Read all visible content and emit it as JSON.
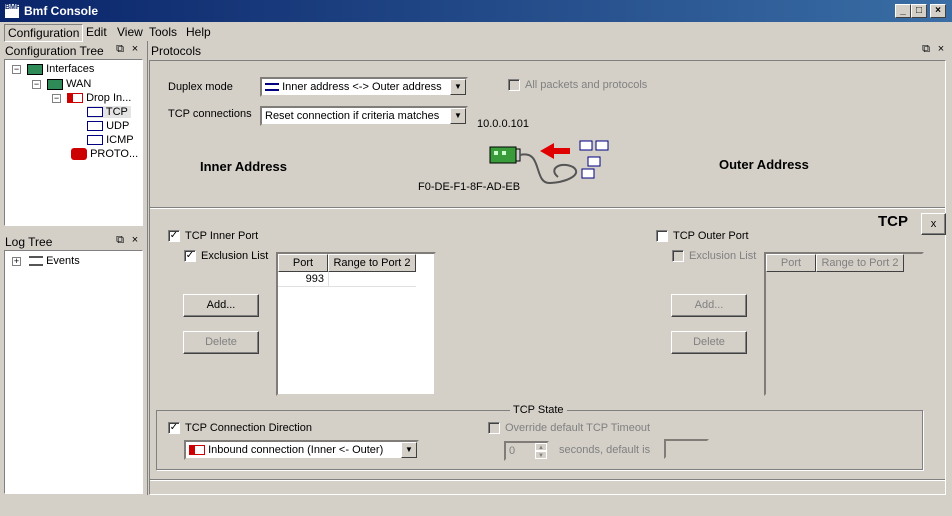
{
  "window": {
    "title": "Bmf Console",
    "icon_text": "BMF"
  },
  "menu": [
    "Configuration",
    "Edit",
    "View",
    "Tools",
    "Help"
  ],
  "config_tree": {
    "title": "Configuration Tree",
    "items": [
      "Interfaces",
      "WAN",
      "Drop In...",
      "TCP",
      "UDP",
      "ICMP",
      "PROTO..."
    ]
  },
  "log_tree": {
    "title": "Log Tree",
    "items": [
      "Events"
    ]
  },
  "protocols": {
    "title": "Protocols",
    "duplex_label": "Duplex mode",
    "duplex_value": "Inner address <-> Outer address",
    "all_packets_label": "All packets and protocols",
    "tcp_conn_label": "TCP connections",
    "tcp_conn_value": "Reset connection if criteria matches",
    "ip": "10.0.0.101",
    "mac": "F0-DE-F1-8F-AD-EB",
    "inner_address": "Inner Address",
    "outer_address": "Outer Address"
  },
  "tcp": {
    "title": "TCP",
    "close": "x",
    "inner_port_label": "TCP Inner Port",
    "inner_exclusion_label": "Exclusion List",
    "col_port": "Port",
    "col_range": "Range to Port 2",
    "inner_rows": [
      {
        "port": "993",
        "range": ""
      }
    ],
    "add": "Add...",
    "delete": "Delete",
    "outer_port_label": "TCP Outer Port",
    "outer_exclusion_label": "Exclusion List",
    "state_title": "TCP State",
    "direction_label": "TCP Connection Direction",
    "direction_value": "Inbound  connection (Inner <- Outer)",
    "override_label": "Override default TCP Timeout",
    "spin_value": "0",
    "seconds_label": "seconds, default is",
    "check_mark": "✓"
  },
  "colors": {
    "title_start": "#0a246a",
    "title_end": "#3a6ea5",
    "face": "#d4d0c8",
    "red_arrow": "#e00000"
  }
}
